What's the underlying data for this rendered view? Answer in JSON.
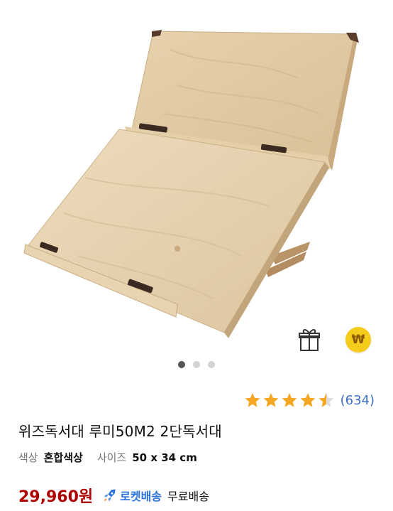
{
  "product": {
    "rating": {
      "stars": 4.5,
      "max": 5,
      "count_text": "(634)"
    },
    "title": "위즈독서대 루미50M2 2단독서대",
    "options": [
      {
        "label": "색상",
        "value": "혼합색상"
      },
      {
        "label": "사이즈",
        "value": "50 x 34 cm"
      }
    ],
    "price": "29,960원",
    "shipping": {
      "rocket_label": "로켓배송",
      "free_label": "무료배송"
    }
  },
  "gallery": {
    "image_count": 3,
    "active_index": 0
  },
  "badges": {
    "wow_symbol": "₩",
    "wow_color": "#f5cc1c"
  },
  "icons": {
    "gift": "gift-icon",
    "wow": "wow-coin-icon",
    "star": "star-icon",
    "rocket": "rocket-icon"
  },
  "colors": {
    "price": "#ae0000",
    "rocket": "#2a71d9",
    "star": "#f5a623",
    "review_count": "#3d6fc2"
  }
}
